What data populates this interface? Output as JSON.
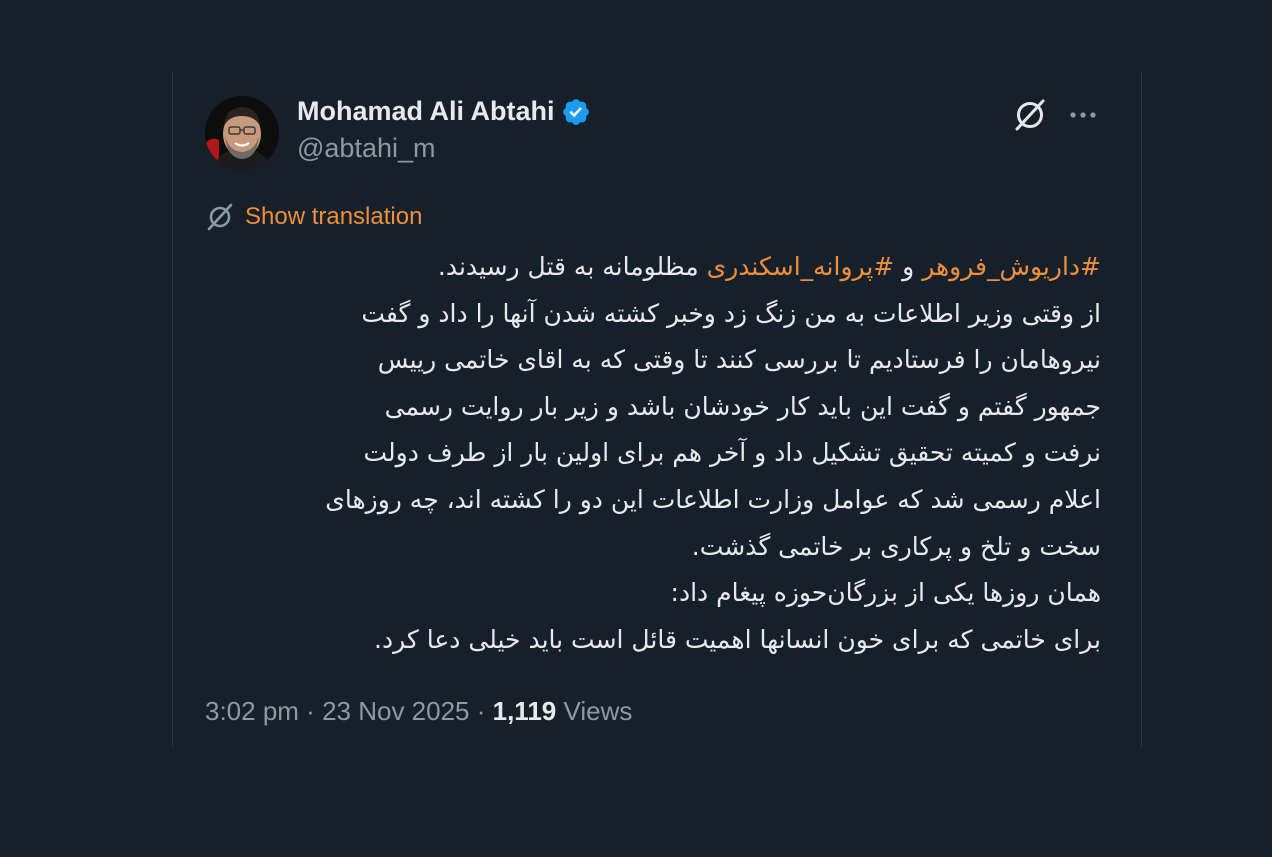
{
  "author": {
    "display_name": "Mohamad Ali Abtahi",
    "handle": "@abtahi_m",
    "verified": true,
    "verified_color": "#1d9bf0"
  },
  "header": {
    "grok_icon": "grok-icon",
    "more_icon": "more-icon"
  },
  "translation": {
    "label": "Show translation",
    "icon": "grok-translate-icon",
    "color": "#ef8f3c"
  },
  "tweet": {
    "line1": {
      "hashtag1": "#داریوش_فروهر",
      "connector": " و ",
      "hashtag2": "#پروانه_اسکندری",
      "rest": " مظلومانه به قتل رسیدند."
    },
    "lines": [
      "از وقتی وزیر اطلاعات به من زنگ زد وخبر کشته شدن آنها را داد و گفت",
      "نیروهامان را فرستادیم تا بررسی کنند تا وقتی که به اقای خاتمی رییس",
      "جمهور گفتم  و گفت این باید کار خودشان باشد و زیر بار روایت رسمی",
      "نرفت و کمیته تحقیق تشکیل داد و آخر هم برای اولین بار از طرف دولت",
      "اعلام رسمی شد که عوامل وزارت اطلاعات این دو را کشته اند، چه روزهای",
      "سخت و تلخ و پرکاری بر خاتمی گذشت.",
      "همان روزها یکی از بزرگان‌حوزه پیغام داد:",
      "برای خاتمی که برای خون انسانها اهمیت قائل است باید خیلی دعا کرد."
    ]
  },
  "meta": {
    "time": "3:02 pm",
    "separator": " · ",
    "date": "23 Nov 2025",
    "views_count": "1,119",
    "views_label": " Views"
  },
  "colors": {
    "background": "#15202b",
    "text": "#e7e9ea",
    "muted": "#8b98a5",
    "accent": "#ef8f3c"
  }
}
